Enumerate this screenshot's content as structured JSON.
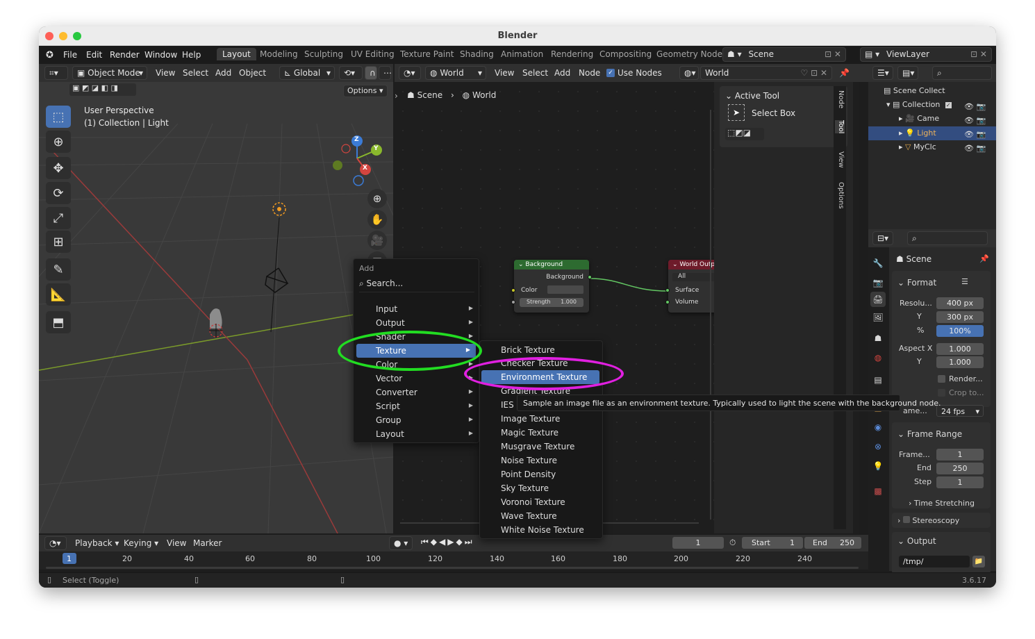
{
  "window": {
    "title": "Blender"
  },
  "menubar": {
    "items": [
      "File",
      "Edit",
      "Render",
      "Window",
      "Help"
    ],
    "workspaces": [
      "Layout",
      "Modeling",
      "Sculpting",
      "UV Editing",
      "Texture Paint",
      "Shading",
      "Animation",
      "Rendering",
      "Compositing",
      "Geometry Nodes"
    ],
    "scene_label": "Scene",
    "viewlayer_label": "ViewLayer"
  },
  "viewport_header": {
    "mode": "Object Mode",
    "menus": [
      "View",
      "Select",
      "Add",
      "Object"
    ],
    "orientation": "Global",
    "options_label": "Options"
  },
  "viewport": {
    "perspective": "User Perspective",
    "collection_info": "(1) Collection | Light",
    "gizmo": {
      "z": "Z",
      "y": "Y",
      "x": "X"
    }
  },
  "node_header": {
    "world_dropdown": "World",
    "menus": [
      "View",
      "Select",
      "Add",
      "Node"
    ],
    "use_nodes_label": "Use Nodes",
    "use_nodes_checked": true,
    "world_field": "World"
  },
  "breadcrumb": {
    "scene": "Scene",
    "world": "World"
  },
  "nodes": {
    "background": {
      "title": "Background",
      "output": "Background",
      "color_label": "Color",
      "strength_label": "Strength",
      "strength_value": "1.000"
    },
    "world_output": {
      "title": "World Outpu",
      "target": "All",
      "surface": "Surface",
      "volume": "Volume"
    }
  },
  "add_menu": {
    "title": "Add",
    "search": "Search...",
    "items": [
      "Input",
      "Output",
      "Shader",
      "Texture",
      "Color",
      "Vector",
      "Converter",
      "Script",
      "Group",
      "Layout"
    ],
    "highlighted": "Texture"
  },
  "texture_menu": {
    "items": [
      "Brick Texture",
      "Checker Texture",
      "Environment Texture",
      "Gradient Texture",
      "IES",
      "Image Texture",
      "Magic Texture",
      "Musgrave Texture",
      "Noise Texture",
      "Point Density",
      "Sky Texture",
      "Voronoi Texture",
      "Wave Texture",
      "White Noise Texture"
    ],
    "highlighted": "Environment Texture"
  },
  "tooltip": "Sample an image file as an environment texture. Typically used to light the scene with the background node.",
  "npanel": {
    "section": "Active Tool",
    "tool": "Select Box",
    "tabs": [
      "Node",
      "Tool",
      "View",
      "Options"
    ]
  },
  "outliner": {
    "root": "Scene Collect",
    "rows": [
      "Collection",
      "Came",
      "Light",
      "MyClc"
    ],
    "selected": "Light"
  },
  "properties": {
    "context": "Scene",
    "format_section": "Format",
    "res_label": "Resolu...",
    "res_x": "400 px",
    "res_y_label": "Y",
    "res_y": "300 px",
    "pct_label": "%",
    "pct": "100%",
    "aspect_label": "Aspect X",
    "aspect_x": "1.000",
    "aspect_y_label": "Y",
    "aspect_y": "1.000",
    "render_label": "Render...",
    "crop_label": "Crop to...",
    "fps_label": "ame...",
    "fps": "24 fps",
    "frame_range_section": "Frame Range",
    "frame_start_label": "Frame...",
    "frame_start": "1",
    "end_label": "End",
    "end": "250",
    "step_label": "Step",
    "step": "1",
    "time_stretching": "Time Stretching",
    "stereoscopy": "Stereoscopy",
    "output_section": "Output",
    "output_path": "/tmp/"
  },
  "timeline": {
    "menus": [
      "Playback",
      "Keying",
      "View",
      "Marker"
    ],
    "current_frame": "1",
    "start_label": "Start",
    "start": "1",
    "end_label": "End",
    "end": "250",
    "ruler": [
      "1",
      "20",
      "40",
      "60",
      "80",
      "100",
      "120",
      "140",
      "160",
      "180",
      "200",
      "220",
      "240"
    ]
  },
  "statusbar": {
    "hint": "Select (Toggle)",
    "version": "3.6.17"
  },
  "annotations": {
    "green": "#22dd22",
    "magenta": "#e020e0"
  },
  "colors": {
    "accent": "#4772b3",
    "selection_highlight": "#334d80"
  }
}
